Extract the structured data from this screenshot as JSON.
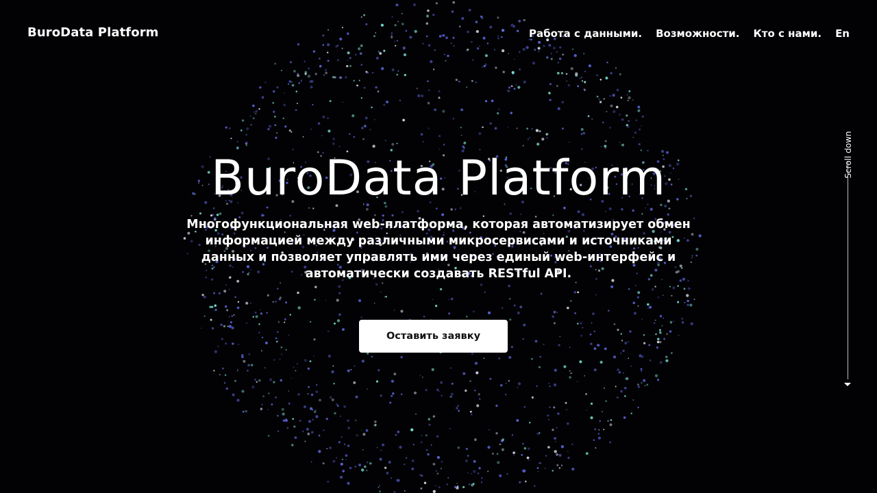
{
  "header": {
    "logo": "BuroData Platform",
    "nav": [
      {
        "label": "Работа с данными."
      },
      {
        "label": "Возможности."
      },
      {
        "label": "Кто с нами."
      },
      {
        "label": "En"
      }
    ]
  },
  "hero": {
    "title": "BuroData Platform",
    "description": "Многофункциональная web-платформа, которая автоматизирует обмен информацией между различными микросервисами и источниками данных и позволяет управлять ими через единый web-интерфейс и автоматически создавать RESTful API.",
    "cta_label": "Оставить заявку"
  },
  "scroll": {
    "label": "Scroll down"
  },
  "colors": {
    "background": "#020204",
    "particle_blue": "#5b63d6",
    "particle_teal": "#7ee6d8",
    "particle_white": "#d8dce8",
    "button_bg": "#ffffff",
    "button_text": "#111111"
  }
}
